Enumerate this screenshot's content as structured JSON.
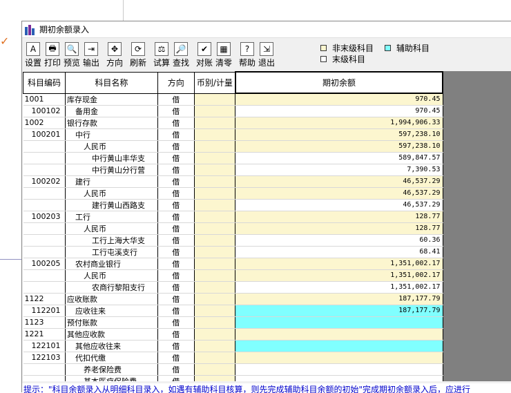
{
  "window": {
    "title": "期初余额录入"
  },
  "toolbar": [
    {
      "label": "设置",
      "icon": "A"
    },
    {
      "label": "打印",
      "icon": "🖶"
    },
    {
      "label": "预览",
      "icon": "🔍"
    },
    {
      "label": "输出",
      "icon": "⇥"
    },
    {
      "sep": true
    },
    {
      "label": "方向",
      "icon": "✥"
    },
    {
      "sep": true
    },
    {
      "label": "刷新",
      "icon": "⟳"
    },
    {
      "sep": true
    },
    {
      "label": "试算",
      "icon": "⚖"
    },
    {
      "label": "查找",
      "icon": "🔎"
    },
    {
      "sep": true
    },
    {
      "label": "对账",
      "icon": "✔"
    },
    {
      "label": "清零",
      "icon": "▦"
    },
    {
      "sep": true
    },
    {
      "label": "帮助",
      "icon": "?"
    },
    {
      "label": "退出",
      "icon": "⇲"
    }
  ],
  "legend": {
    "non_leaf_label": "非末级科目",
    "aux_label": "辅助科目",
    "leaf_label": "末级科目",
    "colors": {
      "non_leaf": "#fcf6cf",
      "aux": "#80ffff",
      "leaf": "#ffffff"
    }
  },
  "table": {
    "headers": [
      "科目编码",
      "科目名称",
      "方向",
      "币别/计量",
      "期初余额"
    ],
    "rows": [
      {
        "code": "1001",
        "indent": 0,
        "name": "库存现金",
        "dir": "借",
        "amount": "970.45",
        "style": "yellow"
      },
      {
        "code": "100102",
        "indent": 1,
        "name": "备用金",
        "dir": "借",
        "amount": "970.45",
        "style": "white"
      },
      {
        "code": "1002",
        "indent": 0,
        "name": "银行存款",
        "dir": "借",
        "amount": "1,994,906.33",
        "style": "yellow"
      },
      {
        "code": "100201",
        "indent": 1,
        "name": "中行",
        "dir": "借",
        "amount": "597,238.10",
        "style": "yellow"
      },
      {
        "code": "",
        "indent": 2,
        "name": "人民币",
        "dir": "借",
        "amount": "597,238.10",
        "style": "yellow"
      },
      {
        "code": "",
        "indent": 3,
        "name": "中行黄山丰华支",
        "dir": "借",
        "amount": "589,847.57",
        "style": "white"
      },
      {
        "code": "",
        "indent": 3,
        "name": "中行黄山分行营",
        "dir": "借",
        "amount": "7,390.53",
        "style": "white"
      },
      {
        "code": "100202",
        "indent": 1,
        "name": "建行",
        "dir": "借",
        "amount": "46,537.29",
        "style": "yellow"
      },
      {
        "code": "",
        "indent": 2,
        "name": "人民币",
        "dir": "借",
        "amount": "46,537.29",
        "style": "yellow"
      },
      {
        "code": "",
        "indent": 3,
        "name": "建行黄山西路支",
        "dir": "借",
        "amount": "46,537.29",
        "style": "white"
      },
      {
        "code": "100203",
        "indent": 1,
        "name": "工行",
        "dir": "借",
        "amount": "128.77",
        "style": "yellow"
      },
      {
        "code": "",
        "indent": 2,
        "name": "人民币",
        "dir": "借",
        "amount": "128.77",
        "style": "yellow"
      },
      {
        "code": "",
        "indent": 3,
        "name": "工行上海大华支",
        "dir": "借",
        "amount": "60.36",
        "style": "white"
      },
      {
        "code": "",
        "indent": 3,
        "name": "工行屯溪支行",
        "dir": "借",
        "amount": "68.41",
        "style": "white"
      },
      {
        "code": "100205",
        "indent": 1,
        "name": "农村商业银行",
        "dir": "借",
        "amount": "1,351,002.17",
        "style": "yellow"
      },
      {
        "code": "",
        "indent": 2,
        "name": "人民币",
        "dir": "借",
        "amount": "1,351,002.17",
        "style": "yellow"
      },
      {
        "code": "",
        "indent": 3,
        "name": "农商行黎阳支行",
        "dir": "借",
        "amount": "1,351,002.17",
        "style": "white"
      },
      {
        "code": "1122",
        "indent": 0,
        "name": "应收账款",
        "dir": "借",
        "amount": "187,177.79",
        "style": "yellow"
      },
      {
        "code": "112201",
        "indent": 1,
        "name": "应收往来",
        "dir": "借",
        "amount": "187,177.79",
        "style": "cyan"
      },
      {
        "code": "1123",
        "indent": 0,
        "name": "预付账款",
        "dir": "借",
        "amount": "",
        "style": "cyan"
      },
      {
        "code": "1221",
        "indent": 0,
        "name": "其他应收款",
        "dir": "借",
        "amount": "",
        "style": "yellow"
      },
      {
        "code": "122101",
        "indent": 1,
        "name": "其他应收往来",
        "dir": "借",
        "amount": "",
        "style": "cyan"
      },
      {
        "code": "122103",
        "indent": 1,
        "name": "代扣代缴",
        "dir": "借",
        "amount": "",
        "style": "yellow"
      },
      {
        "code": "",
        "indent": 2,
        "name": "养老保险费",
        "dir": "借",
        "amount": "",
        "style": "white"
      },
      {
        "code": "",
        "indent": 2,
        "name": "基本医疗保险费",
        "dir": "借",
        "amount": "",
        "style": "white"
      }
    ]
  },
  "status": {
    "hint": "提示：\"科目余额录入从明细科目录入，如遇有辅助科目核算，则先完成辅助科目余额的初始\"完成期初余额录入后，应进行"
  }
}
